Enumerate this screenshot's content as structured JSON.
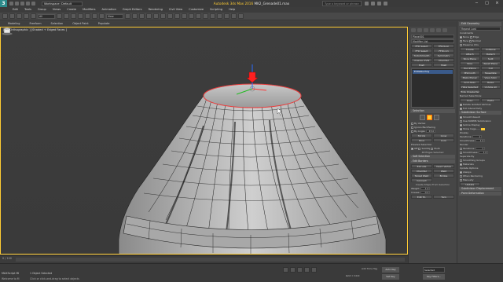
{
  "titlebar": {
    "logo": "3",
    "workspace": "Workspace: Default",
    "app_name": "Autodesk 3ds Max 2016",
    "file_name": "MK2_Grenade01.max",
    "search_placeholder": "Type a keyword or phrase"
  },
  "menubar": [
    "Edit",
    "Tools",
    "Group",
    "Views",
    "Create",
    "Modifiers",
    "Animation",
    "Graph Editors",
    "Rendering",
    "Civil View",
    "Customize",
    "Scripting",
    "Help"
  ],
  "toolbar": {
    "selection_filter": "All",
    "view_dropdown": "View"
  },
  "ribbon": [
    "Modeling",
    "Freeform",
    "Selection",
    "Object Paint",
    "Populate"
  ],
  "viewport": {
    "label": "[+] [Orthographic ] [Shaded + Edged Faces ]"
  },
  "timeline": {
    "frame": "0 / 100"
  },
  "modify_panel": {
    "object_name": "Plane001",
    "modifier_list": "Modifier List",
    "buttons": [
      "FFD Select",
      "FFD(box)",
      "FFD Select",
      "FFD(cyl)",
      "TurboSmooth",
      "Symmetry",
      "Unwrap UVW",
      "Chamfer",
      "Push",
      "Shell"
    ],
    "stack_item": "Editable Poly",
    "selection_header": "Selection",
    "by_vertex": "By Vertex",
    "ignore_backfacing": "Ignore Backfacing",
    "by_angle": "By Angle:",
    "by_angle_value": "45.0",
    "shrink": "Shrink",
    "grow": "Grow",
    "ring": "Ring",
    "loop": "Loop",
    "preview_selection": "Preview Selection",
    "preview_off": "Off",
    "preview_subobj": "SubObj",
    "preview_multi": "Multi",
    "selected_note": "48 Edges Selected",
    "soft_selection": "Soft Selection",
    "edit_borders": "Edit Borders",
    "edit_buttons": [
      "Extrude",
      "Insert Vertex",
      "Chamfer",
      "Weld",
      "Target Weld",
      "Bridge",
      "Connect"
    ],
    "create_shape": "Create Shape From Selection",
    "weight_label": "Weight:",
    "weight_value": "1.0",
    "crease_label": "Crease:",
    "crease_value": "0.0",
    "edit_tri": "Edit Tri.",
    "turn": "Turn"
  },
  "edit_panel": {
    "edit_geometry": "Edit Geometry",
    "repeat_last": "Repeat Last",
    "constraints": "Constraints",
    "none": "None",
    "edge": "Edge",
    "face": "Face",
    "normal": "Normal",
    "preserve_uvs": "Preserve UVs",
    "create": "Create",
    "collapse": "Collapse",
    "attach": "Attach",
    "detach": "Detach",
    "slice_plane": "Slice Plane",
    "split": "Split",
    "slice": "Slice",
    "reset_plane": "Reset Plane",
    "quickslice": "QuickSlice",
    "cut": "Cut",
    "msmooth": "MSmooth",
    "tessellate": "Tessellate",
    "make_planar": "Make Planar",
    "view_align": "View Align",
    "grid_align": "Grid Align",
    "relax": "Relax",
    "hide_selected": "Hide Selected",
    "unhide_all": "Unhide All",
    "hide_unselected": "Hide Unselected",
    "named_selections": "Named Selections:",
    "copy": "Copy",
    "paste": "Paste",
    "delete_isolated": "Delete Isolated Vertices",
    "full_interactivity": "Full Interactivity",
    "subdivision_surface": "Subdivision Surface",
    "smooth_result": "Smooth Result",
    "use_nurms": "Use NURMS Subdivision",
    "isoline_display": "Isoline Display",
    "show_cage": "Show Cage......",
    "display": "Display",
    "iterations_label": "Iterations:",
    "iterations_value": "1",
    "smoothness_label": "Smoothness:",
    "smoothness_value": "1.0",
    "render": "Render",
    "separate_by": "Separate By",
    "smoothing_groups": "Smoothing Groups",
    "materials": "Materials",
    "update_options": "Update Options",
    "always": "Always",
    "when_rendering": "When Rendering",
    "manually": "Manually",
    "update": "Update",
    "subdivision_displacement": "Subdivision Displacement",
    "paint_deformation": "Paint Deformation"
  },
  "status": {
    "maxscript": "MAXScript Mi",
    "welcome": "Welcome to M",
    "selected": "1 Object Selected",
    "prompt": "Click or click-and-drag to select objects",
    "autokey": "Auto Key",
    "setkey": "Set Key",
    "selection_field": "Selected",
    "key_filters": "Key Filters...",
    "add_time_tag": "Add Time Tag",
    "grid": "Grid = 10.0"
  },
  "colors": {
    "accent": "#ffcc33",
    "selection_red": "#ff3333"
  }
}
